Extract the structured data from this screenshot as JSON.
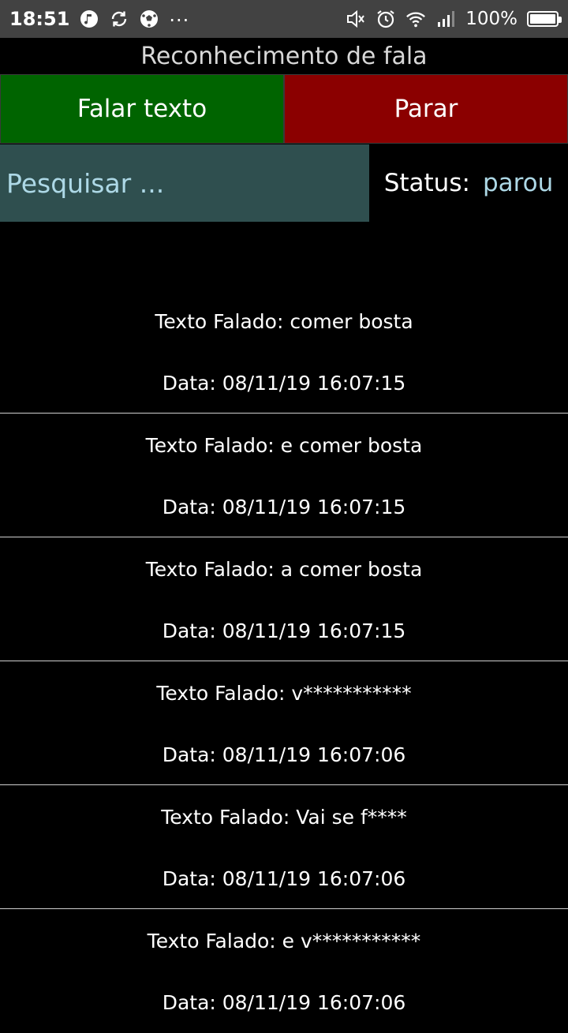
{
  "statusbar": {
    "time": "18:51",
    "battery_text": "100%",
    "left_icons": [
      "music-note-icon",
      "sync-icon",
      "soccer-ball-icon",
      "more-dots-icon"
    ],
    "right_icons": [
      "mute-icon",
      "alarm-icon",
      "wifi-icon",
      "signal-icon",
      "battery-icon"
    ]
  },
  "app": {
    "title": "Reconhecimento de fala"
  },
  "buttons": {
    "speak_label": "Falar texto",
    "stop_label": "Parar",
    "speak_color": "#006400",
    "stop_color": "#8b0000"
  },
  "search": {
    "placeholder": "Pesquisar ...",
    "value": ""
  },
  "status": {
    "label": "Status:",
    "value": "parou"
  },
  "entries": [
    {
      "text": "Texto Falado: comer bosta",
      "date": "Data: 08/11/19 16:07:15"
    },
    {
      "text": "Texto Falado: e comer bosta",
      "date": "Data: 08/11/19 16:07:15"
    },
    {
      "text": "Texto Falado: a comer bosta",
      "date": "Data: 08/11/19 16:07:15"
    },
    {
      "text": "Texto Falado: v***********",
      "date": "Data: 08/11/19 16:07:06"
    },
    {
      "text": "Texto Falado: Vai se f****",
      "date": "Data: 08/11/19 16:07:06"
    },
    {
      "text": "Texto Falado: e v***********",
      "date": "Data: 08/11/19 16:07:06"
    }
  ]
}
